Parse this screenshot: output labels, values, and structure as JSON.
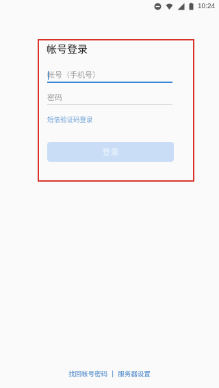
{
  "status_bar": {
    "time": "10:24",
    "icons": [
      "do-not-disturb-icon",
      "wifi-icon",
      "signal-icon",
      "battery-icon"
    ]
  },
  "login": {
    "title": "帐号登录",
    "account_placeholder": "帐号（手机号）",
    "password_placeholder": "密码",
    "sms_login_link": "短信验证码登录",
    "login_button": "登录"
  },
  "footer": {
    "retrieve_password": "找回帐号密码",
    "separator": "|",
    "server_settings": "服务器设置"
  },
  "colors": {
    "highlight_border": "#d9342b",
    "accent_blue": "#3a87d6",
    "button_disabled": "#c9def6"
  }
}
